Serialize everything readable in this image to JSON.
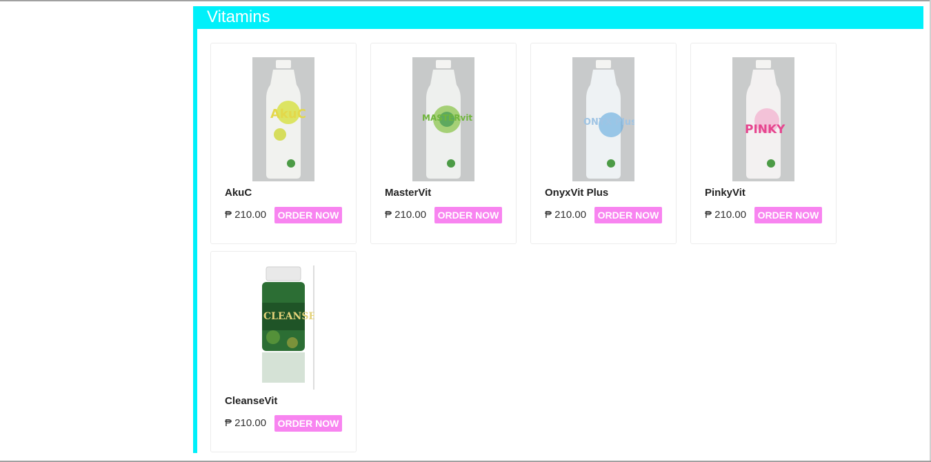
{
  "colors": {
    "accent": "#00f0fa",
    "order_button": "#f884f0"
  },
  "section": {
    "title": "Vitamins"
  },
  "products": [
    {
      "name": "AkuC",
      "price": "₱ 210.00",
      "order_label": "ORDER NOW",
      "image_icon": "akuc-bottle-image",
      "bottle_text": "AkuC",
      "bottle_color": "#e0d648"
    },
    {
      "name": "MasterVit",
      "price": "₱ 210.00",
      "order_label": "ORDER NOW",
      "image_icon": "mastervit-bottle-image",
      "bottle_text": "MASTERvit",
      "bottle_color": "#7dbf3c"
    },
    {
      "name": "OnyxVit Plus",
      "price": "₱ 210.00",
      "order_label": "ORDER NOW",
      "image_icon": "onyxvit-bottle-image",
      "bottle_text": "ONYX Plus",
      "bottle_color": "#5ea6d8"
    },
    {
      "name": "PinkyVit",
      "price": "₱ 210.00",
      "order_label": "ORDER NOW",
      "image_icon": "pinkyvit-bottle-image",
      "bottle_text": "PINKY",
      "bottle_color": "#e6458f"
    },
    {
      "name": "CleanseVit",
      "price": "₱ 210.00",
      "order_label": "ORDER NOW",
      "image_icon": "cleansevit-bottle-image",
      "bottle_text": "CLEANSE",
      "bottle_color": "#2e7a32"
    }
  ]
}
